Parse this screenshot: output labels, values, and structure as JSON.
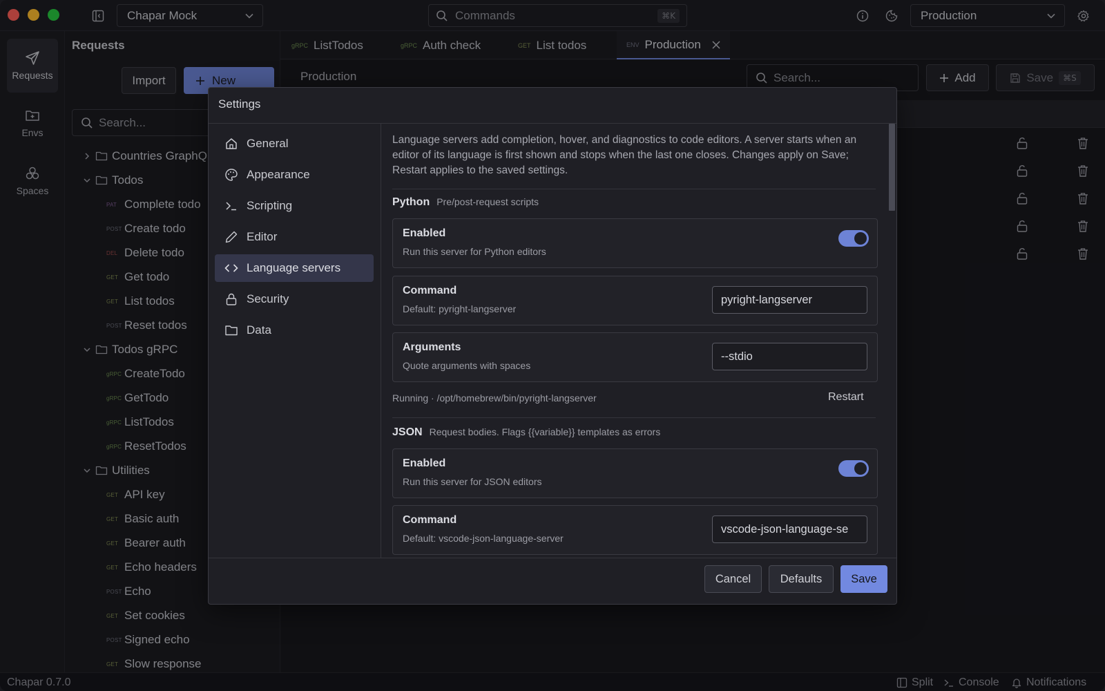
{
  "titlebar": {
    "workspace": "Chapar Mock",
    "commands_placeholder": "Commands",
    "commands_shortcut": "⌘K",
    "environment": "Production"
  },
  "activity": {
    "items": [
      {
        "label": "Requests"
      },
      {
        "label": "Envs"
      },
      {
        "label": "Spaces"
      }
    ]
  },
  "sidebar": {
    "title": "Requests",
    "import_label": "Import",
    "new_label": "New",
    "search_placeholder": "Search...",
    "tree": [
      {
        "kind": "folder",
        "label": "Countries GraphQL",
        "open": false
      },
      {
        "kind": "folder",
        "label": "Todos",
        "open": true
      },
      {
        "kind": "request",
        "method": "PAT",
        "label": "Complete todo"
      },
      {
        "kind": "request",
        "method": "POST",
        "label": "Create todo"
      },
      {
        "kind": "request",
        "method": "DEL",
        "label": "Delete todo"
      },
      {
        "kind": "request",
        "method": "GET",
        "label": "Get todo"
      },
      {
        "kind": "request",
        "method": "GET",
        "label": "List todos"
      },
      {
        "kind": "request",
        "method": "POST",
        "label": "Reset todos"
      },
      {
        "kind": "folder",
        "label": "Todos gRPC",
        "open": true
      },
      {
        "kind": "request",
        "method": "gRPC",
        "label": "CreateTodo"
      },
      {
        "kind": "request",
        "method": "gRPC",
        "label": "GetTodo"
      },
      {
        "kind": "request",
        "method": "gRPC",
        "label": "ListTodos"
      },
      {
        "kind": "request",
        "method": "gRPC",
        "label": "ResetTodos"
      },
      {
        "kind": "folder",
        "label": "Utilities",
        "open": true
      },
      {
        "kind": "request",
        "method": "GET",
        "label": "API key"
      },
      {
        "kind": "request",
        "method": "GET",
        "label": "Basic auth"
      },
      {
        "kind": "request",
        "method": "GET",
        "label": "Bearer auth"
      },
      {
        "kind": "request",
        "method": "GET",
        "label": "Echo headers"
      },
      {
        "kind": "request",
        "method": "POST",
        "label": "Echo"
      },
      {
        "kind": "request",
        "method": "GET",
        "label": "Set cookies"
      },
      {
        "kind": "request",
        "method": "POST",
        "label": "Signed echo"
      },
      {
        "kind": "request",
        "method": "GET",
        "label": "Slow response"
      }
    ]
  },
  "tabs": [
    {
      "tag": "gRPC",
      "label": "ListTodos"
    },
    {
      "tag": "gRPC",
      "label": "Auth check"
    },
    {
      "tag": "GET",
      "label": "List todos"
    },
    {
      "tag": "ENV",
      "label": "Production",
      "active": true
    }
  ],
  "main": {
    "env_name": "Production",
    "search_placeholder": "Search...",
    "add_label": "Add",
    "save_label": "Save",
    "save_shortcut": "⌘S"
  },
  "modal": {
    "title": "Settings",
    "nav": [
      {
        "label": "General",
        "icon": "home-icon"
      },
      {
        "label": "Appearance",
        "icon": "palette-icon"
      },
      {
        "label": "Scripting",
        "icon": "terminal-icon"
      },
      {
        "label": "Editor",
        "icon": "pencil-icon"
      },
      {
        "label": "Language servers",
        "icon": "code-icon",
        "active": true
      },
      {
        "label": "Security",
        "icon": "lock-icon"
      },
      {
        "label": "Data",
        "icon": "folder-icon"
      }
    ],
    "intro": "Language servers add completion, hover, and diagnostics to code editors. A server starts when an editor of its language is first shown and stops when the last one closes. Changes apply on Save; Restart applies to the saved settings.",
    "python": {
      "name": "Python",
      "desc": "Pre/post-request scripts",
      "enabled_label": "Enabled",
      "enabled_sub": "Run this server for Python editors",
      "enabled": true,
      "command_label": "Command",
      "command_sub": "Default: pyright-langserver",
      "command_value": "pyright-langserver",
      "args_label": "Arguments",
      "args_sub": "Quote arguments with spaces",
      "args_value": "--stdio",
      "status": "Running · /opt/homebrew/bin/pyright-langserver",
      "restart_label": "Restart"
    },
    "json": {
      "name": "JSON",
      "desc": "Request bodies. Flags {{variable}} templates as errors",
      "enabled_label": "Enabled",
      "enabled_sub": "Run this server for JSON editors",
      "enabled": true,
      "command_label": "Command",
      "command_sub": "Default: vscode-json-language-server",
      "command_value": "vscode-json-language-se"
    },
    "cancel_label": "Cancel",
    "defaults_label": "Defaults",
    "save_label": "Save"
  },
  "status": {
    "version": "Chapar 0.7.0",
    "split_label": "Split",
    "console_label": "Console",
    "notifications_label": "Notifications"
  },
  "colors": {
    "accent": "#6d83d6",
    "background": "#18181d",
    "panel": "#1f1f25"
  }
}
